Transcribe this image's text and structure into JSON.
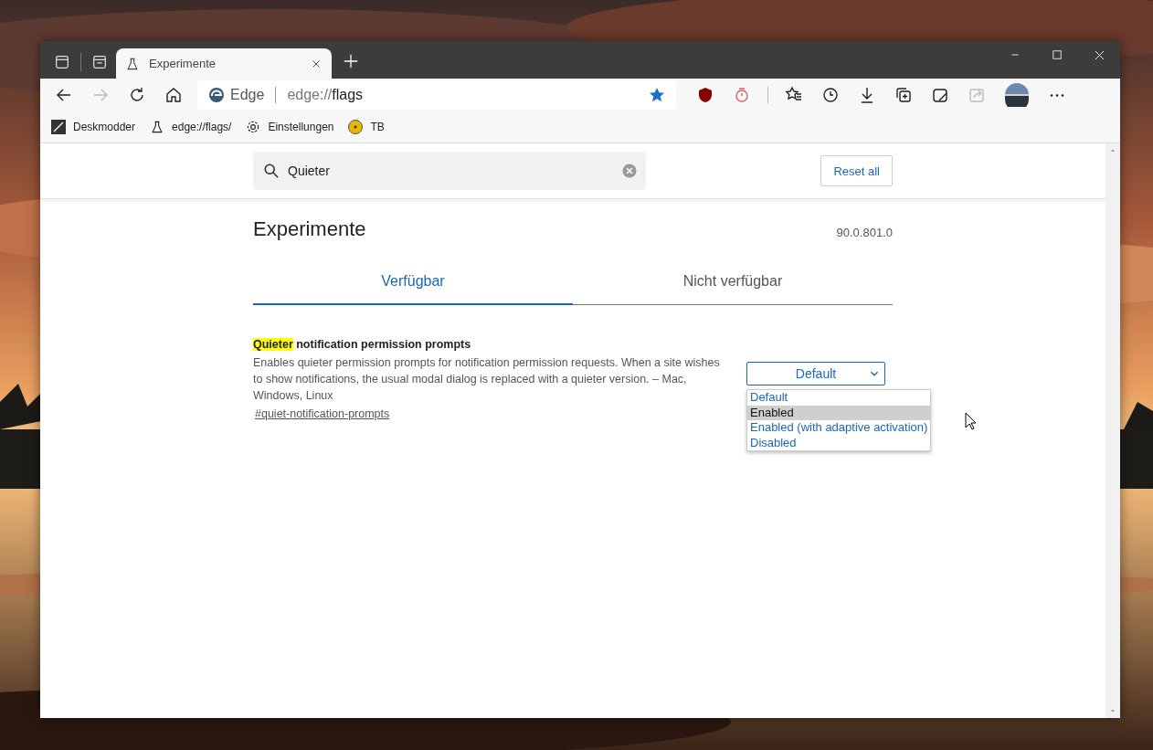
{
  "window": {
    "tab_title": "Experimente"
  },
  "address_bar": {
    "site_label": "Edge",
    "url_prefix": "edge://",
    "url_host": "flags",
    "favorite": true
  },
  "bookmarks": [
    {
      "label": "Deskmodder",
      "kind": "pen"
    },
    {
      "label": "edge://flags/",
      "kind": "flask"
    },
    {
      "label": "Einstellungen",
      "kind": "gear"
    },
    {
      "label": "TB",
      "kind": "disc"
    }
  ],
  "search": {
    "value": "Quieter"
  },
  "reset_button": "Reset all",
  "page": {
    "title": "Experimente",
    "version": "90.0.801.0"
  },
  "tabs": [
    {
      "label": "Verfügbar",
      "selected": true
    },
    {
      "label": "Nicht verfügbar",
      "selected": false
    }
  ],
  "flags": [
    {
      "highlight": "Quieter",
      "title_rest": " notification permission prompts",
      "description": "Enables quieter permission prompts for notification permission requests. When a site wishes to show notifications, the usual modal dialog is replaced with a quieter version. – Mac, Windows, Linux",
      "anchor": "#quiet-notification-prompts",
      "value": "Default",
      "open": true,
      "options": [
        {
          "label": "Default",
          "highlighted": false
        },
        {
          "label": "Enabled",
          "highlighted": true
        },
        {
          "label": "Enabled (with adaptive activation)",
          "highlighted": false
        },
        {
          "label": "Disabled",
          "highlighted": false
        }
      ]
    }
  ]
}
